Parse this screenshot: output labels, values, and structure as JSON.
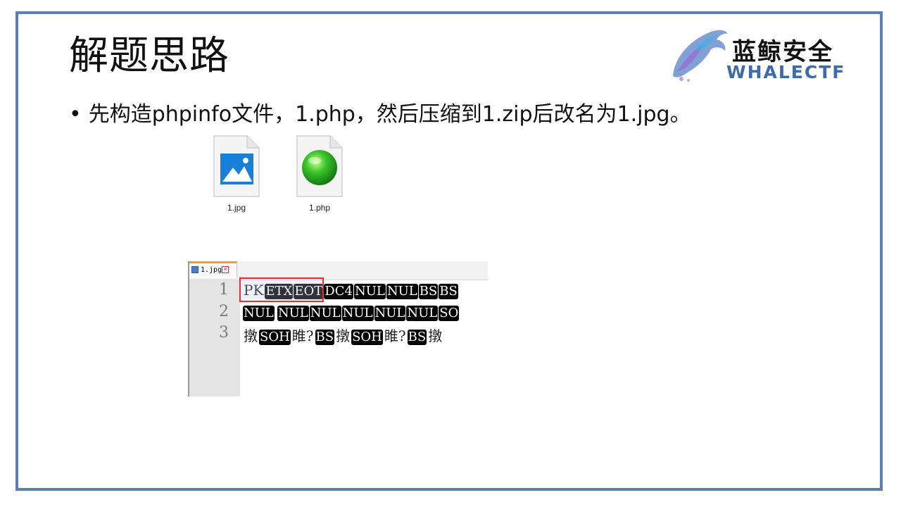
{
  "slide": {
    "title": "解题思路",
    "bullet": "先构造phpinfo文件，1.php，然后压缩到1.zip后改名为1.jpg。"
  },
  "logo": {
    "cn": "蓝鲸安全",
    "en": "WHALECTF"
  },
  "files": [
    {
      "name": "1.jpg",
      "icon": "image-file-icon"
    },
    {
      "name": "1.php",
      "icon": "php-file-icon"
    }
  ],
  "editor": {
    "tab_label": "1.jpg",
    "lines": [
      {
        "num": "1",
        "tokens": [
          {
            "t": "PK",
            "c": false
          },
          {
            "t": "ETX",
            "c": true
          },
          {
            "t": "EOT",
            "c": true
          },
          {
            "t": "DC4",
            "c": true
          },
          {
            "t": "NUL",
            "c": true
          },
          {
            "t": "NUL",
            "c": true
          },
          {
            "t": "BS",
            "c": true
          },
          {
            "t": "BS",
            "c": true
          }
        ]
      },
      {
        "num": "2",
        "tokens": [
          {
            "t": "NUL",
            "c": true
          },
          {
            "t": " ",
            "c": false
          },
          {
            "t": "NUL",
            "c": true
          },
          {
            "t": "NUL",
            "c": true
          },
          {
            "t": "NUL",
            "c": true
          },
          {
            "t": "NUL",
            "c": true
          },
          {
            "t": "NUL",
            "c": true
          },
          {
            "t": "SO",
            "c": true
          }
        ]
      },
      {
        "num": "3",
        "tokens": [
          {
            "t": "撴",
            "c": false
          },
          {
            "t": "SOH",
            "c": true
          },
          {
            "t": "睢?",
            "c": false
          },
          {
            "t": "BS",
            "c": true
          },
          {
            "t": "撴",
            "c": false
          },
          {
            "t": "SOH",
            "c": true
          },
          {
            "t": "睢?",
            "c": false
          },
          {
            "t": "BS",
            "c": true
          },
          {
            "t": "撴",
            "c": false
          }
        ]
      }
    ]
  },
  "colors": {
    "frame": "#5a7fb0",
    "highlight_box": "#e03030",
    "tab_accent": "#f0a030"
  }
}
